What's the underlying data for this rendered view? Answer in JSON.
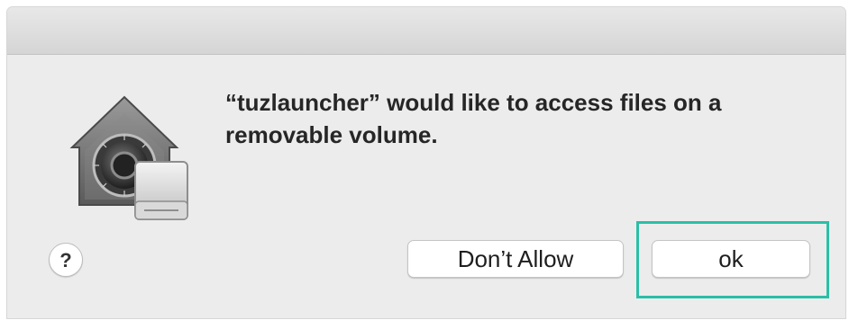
{
  "dialog": {
    "message": "“tuzlauncher” would like to access files on a removable volume.",
    "icon": "security-lock-drive-icon"
  },
  "buttons": {
    "help_label": "?",
    "dont_allow_label": "Don’t Allow",
    "ok_label": "ok"
  },
  "highlight": {
    "color": "#2bbfa7",
    "target": "ok-button"
  }
}
